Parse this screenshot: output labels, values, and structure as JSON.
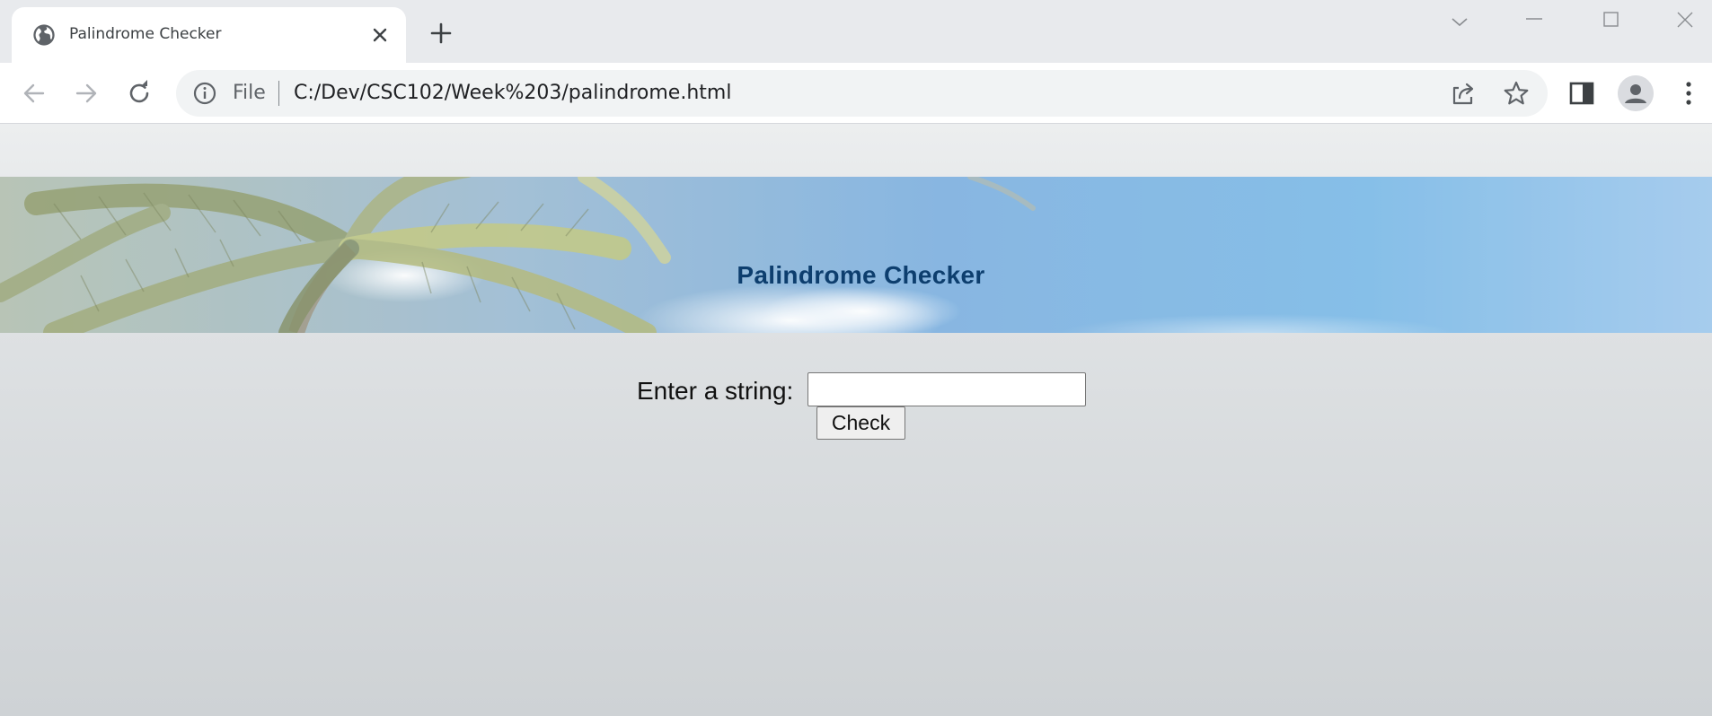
{
  "browser": {
    "tab": {
      "title": "Palindrome Checker",
      "favicon": "globe-icon",
      "close_icon": "close-icon"
    },
    "new_tab_icon": "plus-icon",
    "window_controls": [
      "chevron-down-icon",
      "minimize-icon",
      "maximize-icon",
      "close-icon"
    ],
    "toolbar": {
      "back_icon": "arrow-left-icon",
      "forward_icon": "arrow-right-icon",
      "reload_icon": "reload-icon",
      "omnibox": {
        "info_icon": "info-icon",
        "scheme": "File",
        "url": "C:/Dev/CSC102/Week%203/palindrome.html"
      },
      "share_icon": "share-icon",
      "bookmark_icon": "star-icon",
      "side_panel_icon": "side-panel-icon",
      "profile_icon": "avatar-icon",
      "menu_icon": "kebab-menu-icon"
    }
  },
  "page": {
    "banner": {
      "title": "Palindrome Checker",
      "title_color": "#0d3e6e"
    },
    "form": {
      "label": "Enter a string:",
      "input_value": "",
      "input_placeholder": "",
      "button_label": "Check"
    }
  }
}
